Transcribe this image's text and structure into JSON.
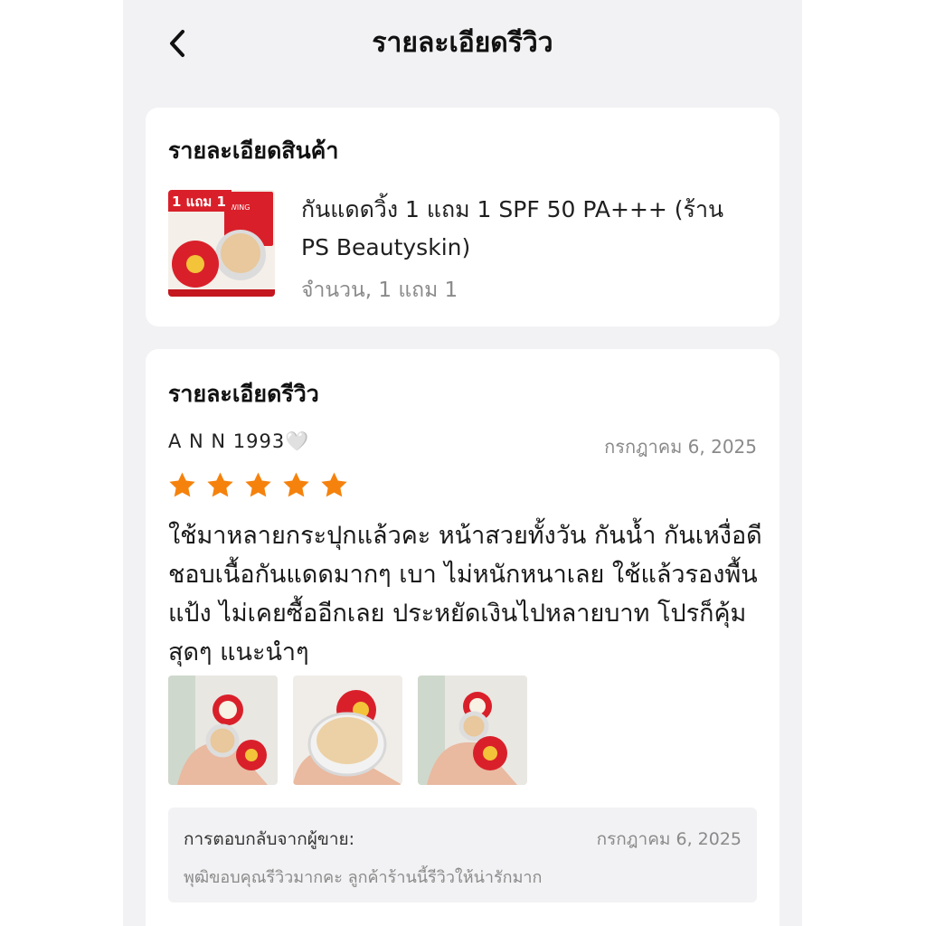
{
  "header": {
    "title": "รายละเอียดรีวิว",
    "back_icon": "chevron-left-icon"
  },
  "product_section": {
    "title": "รายละเอียดสินค้า",
    "product_name": "กันแดดวิ้ง 1 แถม 1 SPF 50 PA+++ (ร้าน PS Beautyskin)",
    "variant": "จำนวน, 1 แถม 1",
    "thumb_banner": "1 แถม 1",
    "thumb_brand": "WING"
  },
  "review_section": {
    "title": "รายละเอียดรีวิว",
    "reviewer": "A N N 1993🤍",
    "date": "กรกฎาคม 6, 2025",
    "rating": 5,
    "rating_max": 5,
    "star_color": "#f5820d",
    "text": "ใช้มาหลายกระปุกแล้วคะ หน้าสวยทั้งวัน กันน้ำ กันเหงื่อดี ชอบเนื้อกันแดดมากๆ เบา ไม่หนักหนาเลย ใช้แล้วรองพื้น แป้ง ไม่เคยซื้ออีกเลย ประหยัดเงินไปหลายบาท  โปรก็คุ้มสุดๆ แนะนำๆ",
    "photo_count": 3,
    "seller_reply": {
      "label": "การตอบกลับจากผู้ขาย:",
      "date": "กรกฎาคม 6, 2025",
      "text": "พุฒิขอบคุณรีวิวมากคะ ลูกค้าร้านนี้รีวิวให้น่ารักมาก"
    }
  },
  "colors": {
    "background": "#f2f2f4",
    "card": "#ffffff",
    "accent_red": "#d9202a",
    "star": "#f5820d"
  }
}
